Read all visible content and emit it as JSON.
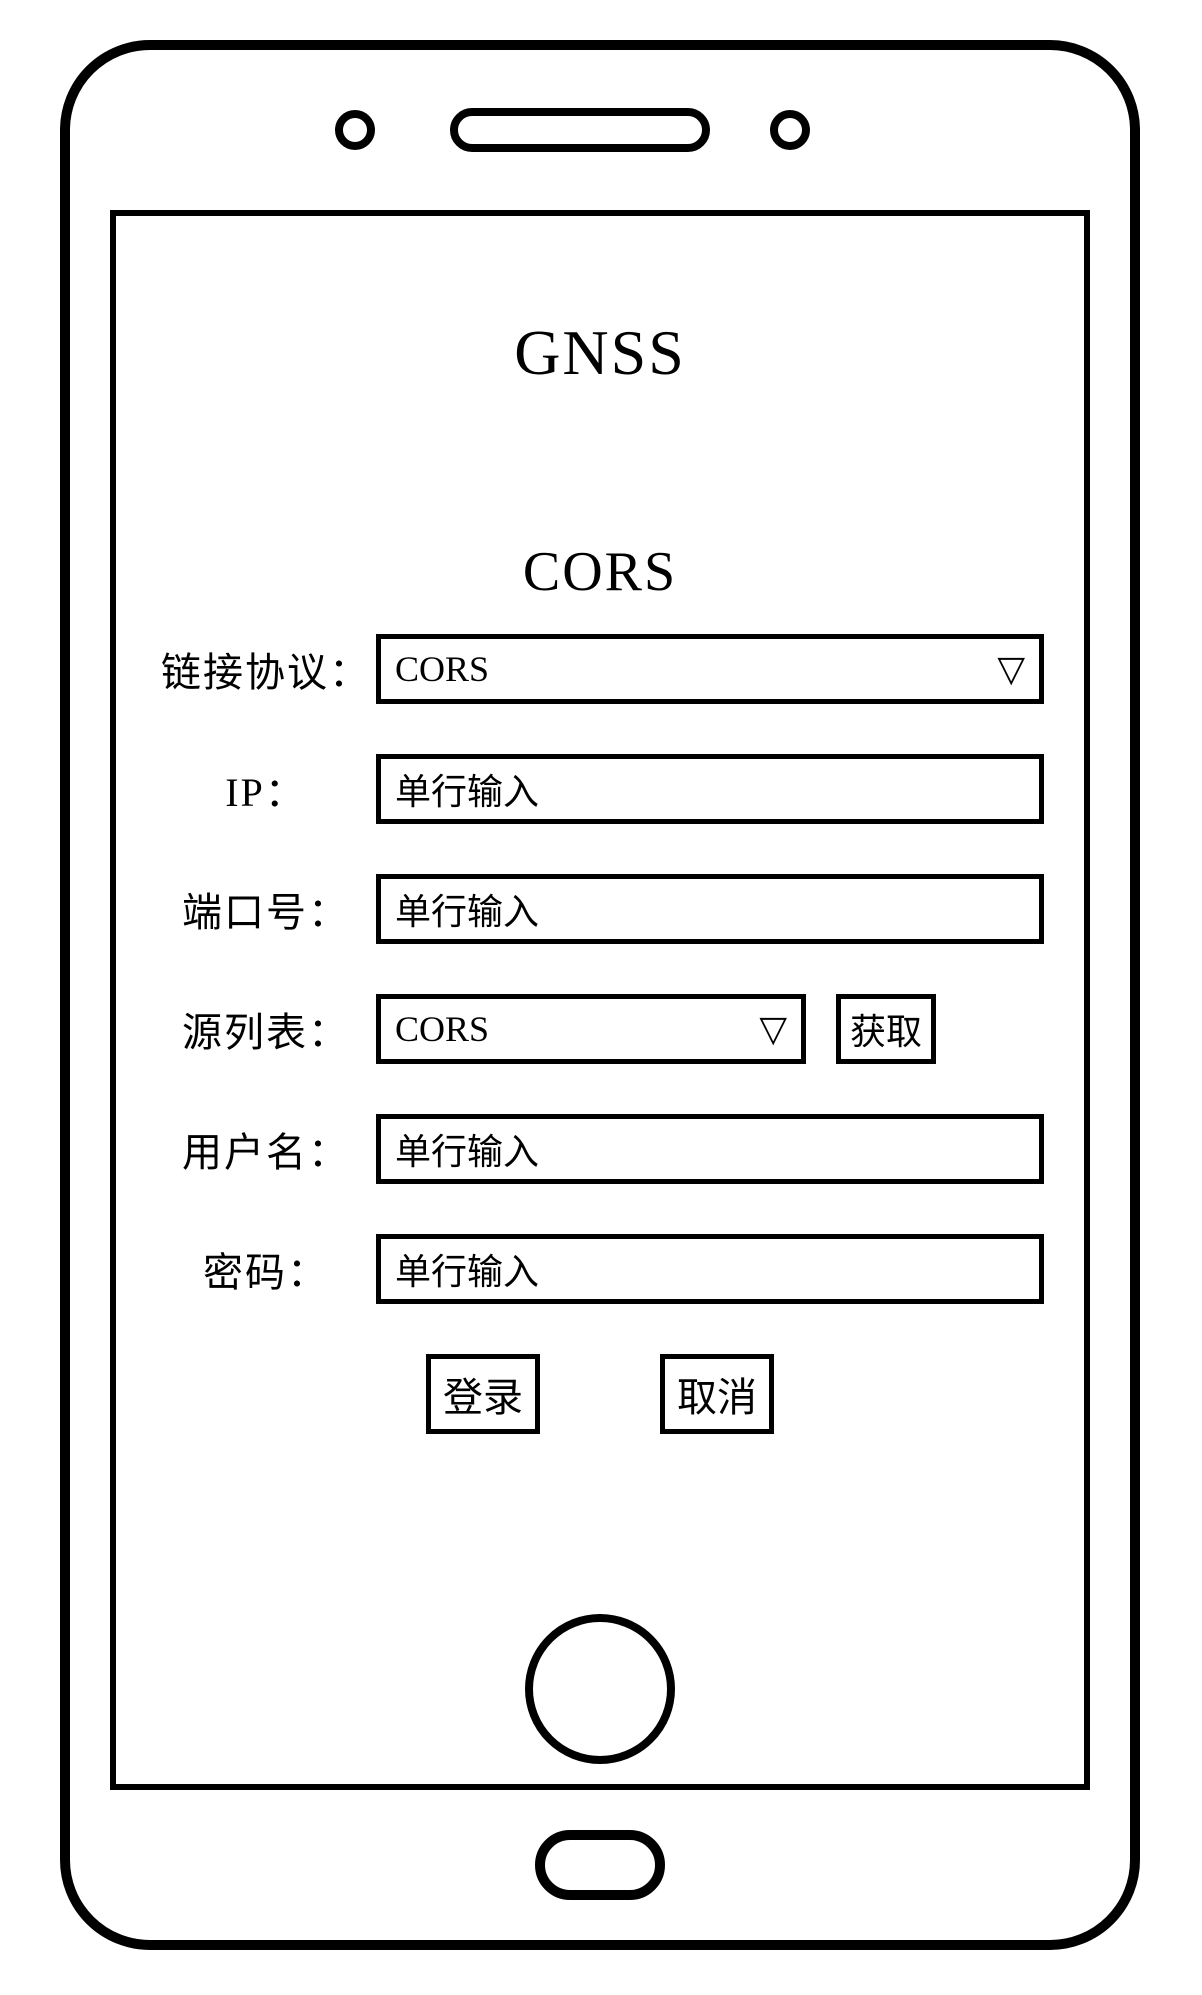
{
  "header": {
    "main_title": "GNSS",
    "sub_title": "CORS"
  },
  "form": {
    "protocol": {
      "label": "链接协议：",
      "selected": "CORS"
    },
    "ip": {
      "label": "IP：",
      "placeholder": "单行输入"
    },
    "port": {
      "label": "端口号：",
      "placeholder": "单行输入"
    },
    "source_list": {
      "label": "源列表：",
      "selected": "CORS",
      "fetch_label": "获取"
    },
    "username": {
      "label": "用户名：",
      "placeholder": "单行输入"
    },
    "password": {
      "label": "密码：",
      "placeholder": "单行输入"
    }
  },
  "buttons": {
    "login": "登录",
    "cancel": "取消"
  },
  "icons": {
    "dropdown": "▽"
  }
}
